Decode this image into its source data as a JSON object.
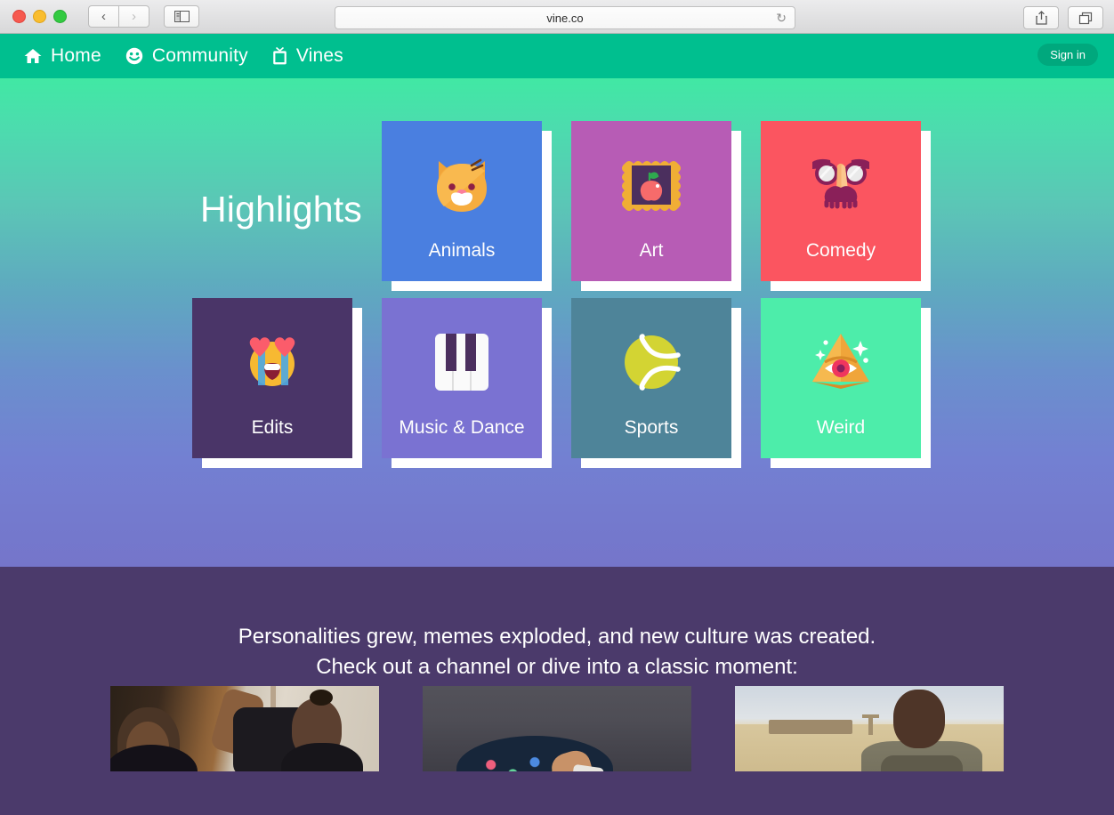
{
  "browser": {
    "url": "vine.co",
    "back_icon": "‹",
    "forward_icon": "›",
    "reload_icon": "↻",
    "traffic_lights": [
      "close",
      "minimize",
      "zoom"
    ]
  },
  "sitenav": {
    "items": [
      {
        "label": "Home",
        "icon": "home-icon"
      },
      {
        "label": "Community",
        "icon": "smiley-face-icon"
      },
      {
        "label": "Vines",
        "icon": "tv-video-icon"
      }
    ],
    "signin_label": "Sign in",
    "bg_color": "#00bf8f",
    "signin_bg": "#00a87d"
  },
  "hero": {
    "title": "Highlights",
    "gradient_from": "#41e8a4",
    "gradient_to": "#7575ca",
    "tiles": [
      {
        "label": "Animals",
        "icon": "cat-face-icon",
        "bg": "#4a7fe0"
      },
      {
        "label": "Art",
        "icon": "framed-apple-icon",
        "bg": "#b75cb5"
      },
      {
        "label": "Comedy",
        "icon": "disguise-glasses-icon",
        "bg": "#fb5560"
      },
      {
        "label": "Edits",
        "icon": "heart-eyes-face-icon",
        "bg": "#4a3568"
      },
      {
        "label": "Music & Dance",
        "icon": "piano-keys-icon",
        "bg": "#7a72d2"
      },
      {
        "label": "Sports",
        "icon": "tennis-ball-icon",
        "bg": "#4e8499"
      },
      {
        "label": "Weird",
        "icon": "eye-pyramid-icon",
        "bg": "#4dedaa"
      }
    ]
  },
  "lower": {
    "bg_color": "#4B3A6B",
    "line1": "Personalities grew, memes exploded, and new culture was created.",
    "line2": "Check out a channel or dive into a classic moment:",
    "thumbnails": [
      {
        "name": "thumbnail-locker-room"
      },
      {
        "name": "thumbnail-dark-room"
      },
      {
        "name": "thumbnail-desert-soldier"
      }
    ]
  }
}
